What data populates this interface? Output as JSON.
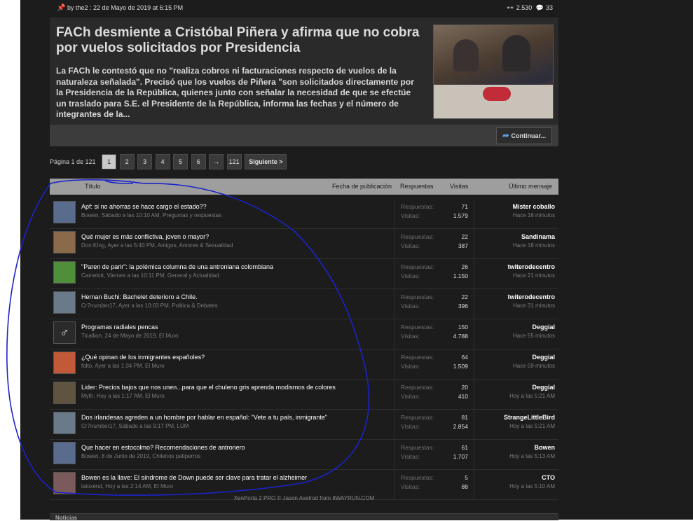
{
  "article": {
    "by_prefix": "by",
    "author": "the2",
    "date_line": ": 22 de Mayo de 2019 at 6:15 PM",
    "views": "2.530",
    "comments": "33",
    "title": "FACh desmiente a Cristóbal Piñera y afirma que no cobra por vuelos solicitados por Presidencia",
    "excerpt": "La FACh le contestó que no \"realiza cobros ni facturaciones respecto de vuelos de la naturaleza señalada\". Precisó que los vuelos de Piñera \"son solicitados directamente por la Presidencia de la República, quienes junto con señalar la necesidad de que se efectúe un traslado para S.E. el Presidente de la República, informa las fechas y el número de integrantes de la...",
    "continue_label": "Continuar..."
  },
  "pagination": {
    "label": "Página 1 de 121",
    "pages": [
      "1",
      "2",
      "3",
      "4",
      "5",
      "6",
      "→",
      "121"
    ],
    "next_label": "Siguiente >"
  },
  "table": {
    "headers": {
      "title": "Título",
      "date": "Fecha de publicación",
      "replies": "Respuestas",
      "views": "Visitas",
      "last": "Último mensaje"
    },
    "stat_labels": {
      "replies": "Respuestas:",
      "views": "Visitas:"
    },
    "rows": [
      {
        "title": "Apf: si no ahorras se hace cargo el estado??",
        "sub": "Bowen, Sábado a las 10:10 AM, Preguntas y respuestas",
        "replies": "71",
        "views": "1.579",
        "last_user": "Mister coballo",
        "last_time": "Hace 16 minutos",
        "avatar": "#5a6c8e"
      },
      {
        "title": "Qué mujer es más conflictiva, joven o mayor?",
        "sub": "Don KIng, Ayer a las 5:40 PM, Amigos, Amores & Sexualidad",
        "replies": "22",
        "views": "387",
        "last_user": "Sandinama",
        "last_time": "Hace 18 minutos",
        "avatar": "#8a6a4a"
      },
      {
        "title": "\"Paren de parir\": la polémica columna de una antroniana colombiana",
        "sub": "Camelott, Viernes a las 10:11 PM, General y Actualidad",
        "replies": "26",
        "views": "1.150",
        "last_user": "twiterodecentro",
        "last_time": "Hace 21 minutos",
        "avatar": "#4f8e3a"
      },
      {
        "title": "Hernan Buchi: Bachelet deterioro a Chile.",
        "sub": "Cr7number17, Ayer a las 10:03 PM, Politica & Debates",
        "replies": "22",
        "views": "396",
        "last_user": "twiterodecentro",
        "last_time": "Hace 31 minutos",
        "avatar": "#6a7a8a"
      },
      {
        "title": "Programas radiales pencas",
        "sub": "Ticallion, 24 de Mayo de 2019, El Muro",
        "replies": "150",
        "views": "4.788",
        "last_user": "Deggial",
        "last_time": "Hace 55 minutos",
        "avatar": "#2a2a2a"
      },
      {
        "title": "¿Qué opinan de los inmigrantes españoles?",
        "sub": "folto, Ayer a las 1:34 PM, El Muro",
        "replies": "64",
        "views": "1.509",
        "last_user": "Deggial",
        "last_time": "Hace 59 minutos",
        "avatar": "#c25a3a"
      },
      {
        "title": "Lider: Precios bajos que nos unen...para que el chuleno gris aprenda modismos de colores",
        "sub": "Myth, Hoy a las 1:17 AM, El Muro",
        "replies": "20",
        "views": "410",
        "last_user": "Deggial",
        "last_time": "Hoy a las 5:21 AM",
        "avatar": "#5e5440"
      },
      {
        "title": "Dos irlandesas agreden a un hombre por hablar en español: \"Vete a tu país, inmigrante\"",
        "sub": "Cr7number17, Sábado a las 9:17 PM, LUM",
        "replies": "81",
        "views": "2.854",
        "last_user": "StrangeLittleBird",
        "last_time": "Hoy a las 5:21 AM",
        "avatar": "#6a7a8a"
      },
      {
        "title": "Que hacer en estocolmo? Recomendaciones de antronero",
        "sub": "Bowen, 8 de Junio de 2019, Chilenos patiperros",
        "replies": "61",
        "views": "1.707",
        "last_user": "Bowen",
        "last_time": "Hoy a las 5:13 AM",
        "avatar": "#5a6c8e"
      },
      {
        "title": "Bowen es la llave: El síndrome de Down puede ser clave para tratar el alzheimer",
        "sub": "laloxend, Hoy a las 2:14 AM, El Muro",
        "replies": "5",
        "views": "88",
        "last_user": "CTO",
        "last_time": "Hoy a las 5:10 AM",
        "avatar": "#7a5a5a"
      }
    ]
  },
  "credit": "XenPorta 2 PRO © Jason Axelrod from 8WAYRUN.COM",
  "bottom_tab": "Noticias",
  "colors": {
    "background": "#1c1c1c",
    "header_bar": "#9e9e9e",
    "annotation": "#1a23c8",
    "pin": "#d9372f",
    "continue_icon": "#5aa0e0"
  }
}
